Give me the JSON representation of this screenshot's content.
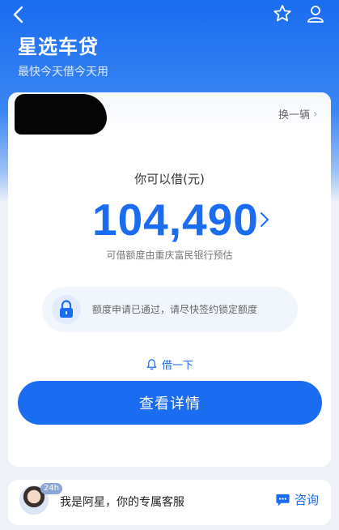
{
  "header": {
    "title": "星选车贷",
    "subtitle": "最快今天借今天用"
  },
  "card": {
    "switch_label": "换一辆",
    "amount_label": "你可以借(元)",
    "amount": "104,490",
    "lender_note": "可借额度由重庆富民银行预估",
    "status_text": "额度申请已通过，请尽快签约锁定额度",
    "borrow_link": "借一下",
    "detail_button": "查看详情"
  },
  "service": {
    "badge": "24h",
    "text": "我是阿星，你的专属客服",
    "consult_label": "咨询"
  },
  "colors": {
    "accent": "#1a6cf0",
    "text_primary": "#222222"
  },
  "icons": [
    "back-arrow-icon",
    "star-icon",
    "user-icon",
    "lock-icon",
    "bell-icon",
    "chat-icon",
    "chevron-right-icon"
  ]
}
